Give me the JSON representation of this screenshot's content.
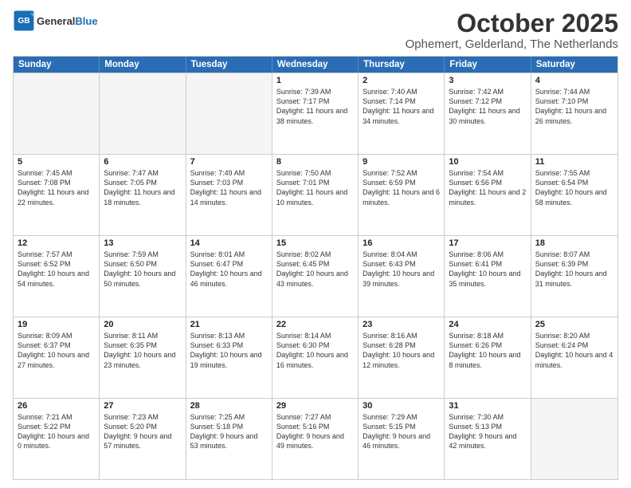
{
  "header": {
    "logo_line1": "General",
    "logo_line2": "Blue",
    "month": "October 2025",
    "location": "Ophemert, Gelderland, The Netherlands"
  },
  "days_of_week": [
    "Sunday",
    "Monday",
    "Tuesday",
    "Wednesday",
    "Thursday",
    "Friday",
    "Saturday"
  ],
  "weeks": [
    [
      {
        "day": "",
        "info": "",
        "empty": true
      },
      {
        "day": "",
        "info": "",
        "empty": true
      },
      {
        "day": "",
        "info": "",
        "empty": true
      },
      {
        "day": "1",
        "info": "Sunrise: 7:39 AM\nSunset: 7:17 PM\nDaylight: 11 hours\nand 38 minutes.",
        "empty": false
      },
      {
        "day": "2",
        "info": "Sunrise: 7:40 AM\nSunset: 7:14 PM\nDaylight: 11 hours\nand 34 minutes.",
        "empty": false
      },
      {
        "day": "3",
        "info": "Sunrise: 7:42 AM\nSunset: 7:12 PM\nDaylight: 11 hours\nand 30 minutes.",
        "empty": false
      },
      {
        "day": "4",
        "info": "Sunrise: 7:44 AM\nSunset: 7:10 PM\nDaylight: 11 hours\nand 26 minutes.",
        "empty": false
      }
    ],
    [
      {
        "day": "5",
        "info": "Sunrise: 7:45 AM\nSunset: 7:08 PM\nDaylight: 11 hours\nand 22 minutes.",
        "empty": false
      },
      {
        "day": "6",
        "info": "Sunrise: 7:47 AM\nSunset: 7:05 PM\nDaylight: 11 hours\nand 18 minutes.",
        "empty": false
      },
      {
        "day": "7",
        "info": "Sunrise: 7:49 AM\nSunset: 7:03 PM\nDaylight: 11 hours\nand 14 minutes.",
        "empty": false
      },
      {
        "day": "8",
        "info": "Sunrise: 7:50 AM\nSunset: 7:01 PM\nDaylight: 11 hours\nand 10 minutes.",
        "empty": false
      },
      {
        "day": "9",
        "info": "Sunrise: 7:52 AM\nSunset: 6:59 PM\nDaylight: 11 hours\nand 6 minutes.",
        "empty": false
      },
      {
        "day": "10",
        "info": "Sunrise: 7:54 AM\nSunset: 6:56 PM\nDaylight: 11 hours\nand 2 minutes.",
        "empty": false
      },
      {
        "day": "11",
        "info": "Sunrise: 7:55 AM\nSunset: 6:54 PM\nDaylight: 10 hours\nand 58 minutes.",
        "empty": false
      }
    ],
    [
      {
        "day": "12",
        "info": "Sunrise: 7:57 AM\nSunset: 6:52 PM\nDaylight: 10 hours\nand 54 minutes.",
        "empty": false
      },
      {
        "day": "13",
        "info": "Sunrise: 7:59 AM\nSunset: 6:50 PM\nDaylight: 10 hours\nand 50 minutes.",
        "empty": false
      },
      {
        "day": "14",
        "info": "Sunrise: 8:01 AM\nSunset: 6:47 PM\nDaylight: 10 hours\nand 46 minutes.",
        "empty": false
      },
      {
        "day": "15",
        "info": "Sunrise: 8:02 AM\nSunset: 6:45 PM\nDaylight: 10 hours\nand 43 minutes.",
        "empty": false
      },
      {
        "day": "16",
        "info": "Sunrise: 8:04 AM\nSunset: 6:43 PM\nDaylight: 10 hours\nand 39 minutes.",
        "empty": false
      },
      {
        "day": "17",
        "info": "Sunrise: 8:06 AM\nSunset: 6:41 PM\nDaylight: 10 hours\nand 35 minutes.",
        "empty": false
      },
      {
        "day": "18",
        "info": "Sunrise: 8:07 AM\nSunset: 6:39 PM\nDaylight: 10 hours\nand 31 minutes.",
        "empty": false
      }
    ],
    [
      {
        "day": "19",
        "info": "Sunrise: 8:09 AM\nSunset: 6:37 PM\nDaylight: 10 hours\nand 27 minutes.",
        "empty": false
      },
      {
        "day": "20",
        "info": "Sunrise: 8:11 AM\nSunset: 6:35 PM\nDaylight: 10 hours\nand 23 minutes.",
        "empty": false
      },
      {
        "day": "21",
        "info": "Sunrise: 8:13 AM\nSunset: 6:33 PM\nDaylight: 10 hours\nand 19 minutes.",
        "empty": false
      },
      {
        "day": "22",
        "info": "Sunrise: 8:14 AM\nSunset: 6:30 PM\nDaylight: 10 hours\nand 16 minutes.",
        "empty": false
      },
      {
        "day": "23",
        "info": "Sunrise: 8:16 AM\nSunset: 6:28 PM\nDaylight: 10 hours\nand 12 minutes.",
        "empty": false
      },
      {
        "day": "24",
        "info": "Sunrise: 8:18 AM\nSunset: 6:26 PM\nDaylight: 10 hours\nand 8 minutes.",
        "empty": false
      },
      {
        "day": "25",
        "info": "Sunrise: 8:20 AM\nSunset: 6:24 PM\nDaylight: 10 hours\nand 4 minutes.",
        "empty": false
      }
    ],
    [
      {
        "day": "26",
        "info": "Sunrise: 7:21 AM\nSunset: 5:22 PM\nDaylight: 10 hours\nand 0 minutes.",
        "empty": false
      },
      {
        "day": "27",
        "info": "Sunrise: 7:23 AM\nSunset: 5:20 PM\nDaylight: 9 hours\nand 57 minutes.",
        "empty": false
      },
      {
        "day": "28",
        "info": "Sunrise: 7:25 AM\nSunset: 5:18 PM\nDaylight: 9 hours\nand 53 minutes.",
        "empty": false
      },
      {
        "day": "29",
        "info": "Sunrise: 7:27 AM\nSunset: 5:16 PM\nDaylight: 9 hours\nand 49 minutes.",
        "empty": false
      },
      {
        "day": "30",
        "info": "Sunrise: 7:29 AM\nSunset: 5:15 PM\nDaylight: 9 hours\nand 46 minutes.",
        "empty": false
      },
      {
        "day": "31",
        "info": "Sunrise: 7:30 AM\nSunset: 5:13 PM\nDaylight: 9 hours\nand 42 minutes.",
        "empty": false
      },
      {
        "day": "",
        "info": "",
        "empty": true,
        "shaded": true
      }
    ]
  ]
}
